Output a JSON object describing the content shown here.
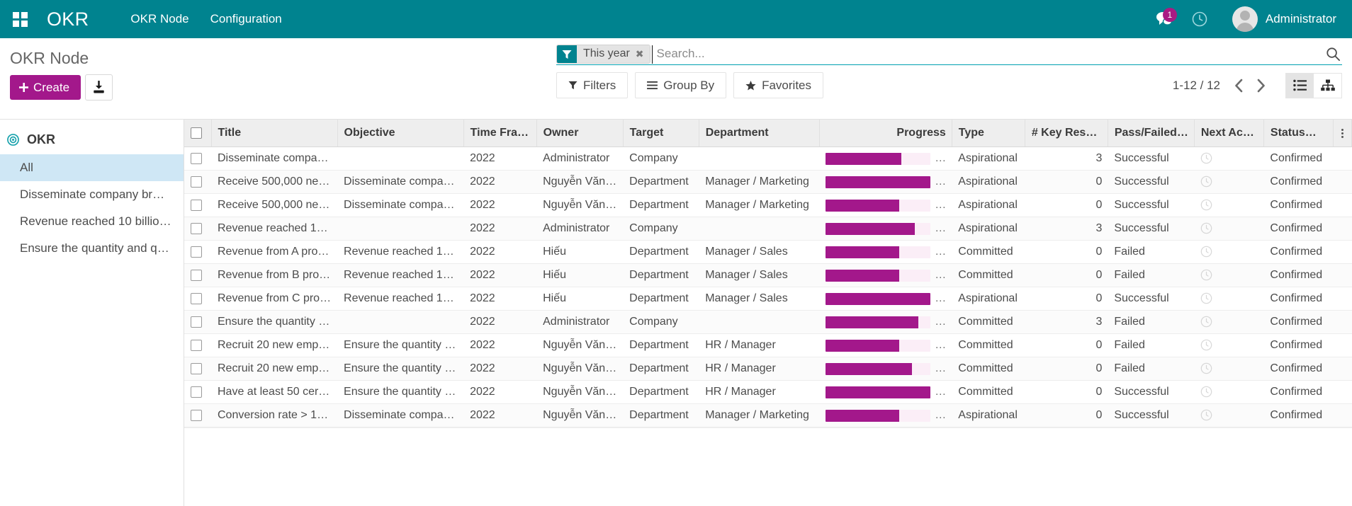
{
  "navbar": {
    "apps_menu_label": "Apps",
    "brand": "OKR",
    "menu_items": [
      {
        "label": "OKR Node"
      },
      {
        "label": "Configuration"
      }
    ],
    "messages_badge": "1",
    "user_name": "Administrator",
    "background_color": "#00838f"
  },
  "control_panel": {
    "breadcrumb": "OKR Node",
    "create_label": "Create",
    "export_label": "",
    "search": {
      "facet_label": "This year",
      "facet_remove": "✖",
      "placeholder": "Search...",
      "value": ""
    },
    "filters_label": "Filters",
    "group_by_label": "Group By",
    "favorites_label": "Favorites",
    "pager": "1-12 / 12",
    "views": [
      {
        "name": "list",
        "active": true
      },
      {
        "name": "hierarchy",
        "active": false
      }
    ]
  },
  "sidebar": {
    "title": "OKR",
    "items": [
      {
        "label": "All",
        "active": true
      },
      {
        "label": "Disseminate company br…",
        "active": false
      },
      {
        "label": "Revenue reached 10 billio…",
        "active": false
      },
      {
        "label": "Ensure the quantity and q…",
        "active": false
      }
    ]
  },
  "table": {
    "columns": [
      "Title",
      "Objective",
      "Time Fra…",
      "Owner",
      "Target",
      "Department",
      "Progress",
      "Type",
      "# Key Results",
      "Pass/Failed…",
      "Next Activi…",
      "Status…"
    ],
    "rows": [
      {
        "title": "Disseminate compa…",
        "objective": "",
        "time_frame": "2022",
        "owner": "Administrator",
        "target": "Company",
        "department": "",
        "progress": 72,
        "progress_label": "…",
        "type": "Aspirational",
        "key_results": "3",
        "pass_failed": "Successful",
        "status": "Confirmed"
      },
      {
        "title": "Receive 500,000 ne…",
        "objective": "Disseminate compa…",
        "time_frame": "2022",
        "owner": "Nguyễn Văn …",
        "target": "Department",
        "department": "Manager / Marketing",
        "progress": 100,
        "progress_label": "…",
        "type": "Aspirational",
        "key_results": "0",
        "pass_failed": "Successful",
        "status": "Confirmed"
      },
      {
        "title": "Receive 500,000 ne…",
        "objective": "Disseminate compa…",
        "time_frame": "2022",
        "owner": "Nguyễn Văn …",
        "target": "Department",
        "department": "Manager / Marketing",
        "progress": 70,
        "progress_label": "…",
        "type": "Aspirational",
        "key_results": "0",
        "pass_failed": "Successful",
        "status": "Confirmed"
      },
      {
        "title": "Revenue reached 10…",
        "objective": "",
        "time_frame": "2022",
        "owner": "Administrator",
        "target": "Company",
        "department": "",
        "progress": 85,
        "progress_label": "…",
        "type": "Aspirational",
        "key_results": "3",
        "pass_failed": "Successful",
        "status": "Confirmed"
      },
      {
        "title": "Revenue from A pro…",
        "objective": "Revenue reached 10…",
        "time_frame": "2022",
        "owner": "Hiếu",
        "target": "Department",
        "department": "Manager / Sales",
        "progress": 70,
        "progress_label": "…",
        "type": "Committed",
        "key_results": "0",
        "pass_failed": "Failed",
        "status": "Confirmed"
      },
      {
        "title": "Revenue from B pro…",
        "objective": "Revenue reached 10…",
        "time_frame": "2022",
        "owner": "Hiếu",
        "target": "Department",
        "department": "Manager / Sales",
        "progress": 70,
        "progress_label": "…",
        "type": "Committed",
        "key_results": "0",
        "pass_failed": "Failed",
        "status": "Confirmed"
      },
      {
        "title": "Revenue from C pro…",
        "objective": "Revenue reached 10…",
        "time_frame": "2022",
        "owner": "Hiếu",
        "target": "Department",
        "department": "Manager / Sales",
        "progress": 100,
        "progress_label": "…",
        "type": "Aspirational",
        "key_results": "0",
        "pass_failed": "Successful",
        "status": "Confirmed"
      },
      {
        "title": "Ensure the quantity …",
        "objective": "",
        "time_frame": "2022",
        "owner": "Administrator",
        "target": "Company",
        "department": "",
        "progress": 88,
        "progress_label": "…",
        "type": "Committed",
        "key_results": "3",
        "pass_failed": "Failed",
        "status": "Confirmed"
      },
      {
        "title": "Recruit 20 new empl…",
        "objective": "Ensure the quantity …",
        "time_frame": "2022",
        "owner": "Nguyễn Văn …",
        "target": "Department",
        "department": "HR / Manager",
        "progress": 70,
        "progress_label": "…",
        "type": "Committed",
        "key_results": "0",
        "pass_failed": "Failed",
        "status": "Confirmed"
      },
      {
        "title": "Recruit 20 new empl…",
        "objective": "Ensure the quantity …",
        "time_frame": "2022",
        "owner": "Nguyễn Văn …",
        "target": "Department",
        "department": "HR / Manager",
        "progress": 82,
        "progress_label": "…",
        "type": "Committed",
        "key_results": "0",
        "pass_failed": "Failed",
        "status": "Confirmed"
      },
      {
        "title": "Have at least 50 cer…",
        "objective": "Ensure the quantity …",
        "time_frame": "2022",
        "owner": "Nguyễn Văn …",
        "target": "Department",
        "department": "HR / Manager",
        "progress": 100,
        "progress_label": "…",
        "type": "Committed",
        "key_results": "0",
        "pass_failed": "Successful",
        "status": "Confirmed"
      },
      {
        "title": "Conversion rate > 1…",
        "objective": "Disseminate compa…",
        "time_frame": "2022",
        "owner": "Nguyễn Văn …",
        "target": "Department",
        "department": "Manager / Marketing",
        "progress": 70,
        "progress_label": "…",
        "type": "Aspirational",
        "key_results": "0",
        "pass_failed": "Successful",
        "status": "Confirmed"
      }
    ]
  },
  "colors": {
    "brand_teal": "#00838f",
    "accent_purple": "#a3188b",
    "selected_sidebar": "#cfe7f5",
    "progress_track": "#fbeef7"
  }
}
